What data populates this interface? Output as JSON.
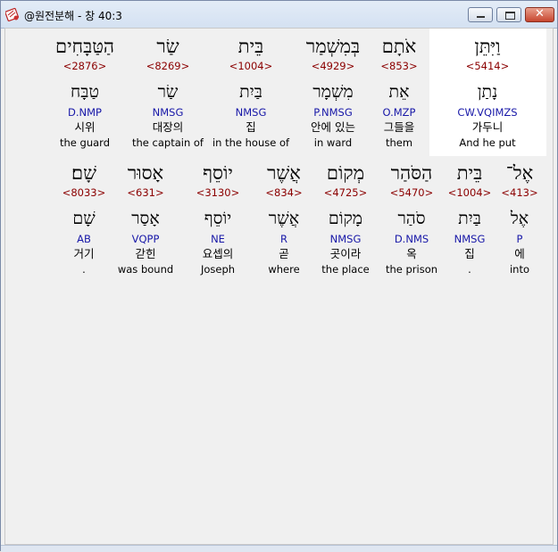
{
  "window": {
    "title": "@원전분해 - 창 40:3",
    "app_icon": "bible-tool-icon",
    "controls": [
      "minimize",
      "maximize",
      "close"
    ],
    "close_glyph": "✕"
  },
  "row1": [
    {
      "hebrew": "וַיִּתֵּן",
      "strong": "<5414>",
      "root": "נָתַן",
      "parse": "CW.VQIMZS",
      "korean": "가두니",
      "english": "And he put"
    },
    {
      "hebrew": "אֹתָם",
      "strong": "<853>",
      "root": "אֵת",
      "parse": "O.MZP",
      "korean": "그들을",
      "english": "them"
    },
    {
      "hebrew": "בְּמִשְׁמַר",
      "strong": "<4929>",
      "root": "מִשְׁמָר",
      "parse": "P.NMSG",
      "korean": "안에 있는",
      "english": "in ward"
    },
    {
      "hebrew": "בֵּית",
      "strong": "<1004>",
      "root": "בַּיִת",
      "parse": "NMSG",
      "korean": "집",
      "english": "in the house of"
    },
    {
      "hebrew": "שַׂר",
      "strong": "<8269>",
      "root": "שַׂר",
      "parse": "NMSG",
      "korean": "대장의",
      "english": "the captain of"
    },
    {
      "hebrew": "הַטַּבָּחִים",
      "strong": "<2876>",
      "root": "טַבָּח",
      "parse": "D.NMP",
      "korean": "시위",
      "english": "the guard"
    }
  ],
  "row2": [
    {
      "hebrew": "אֶל־",
      "strong": "<413>",
      "root": "אֶל",
      "parse": "P",
      "korean": "에",
      "english": "into"
    },
    {
      "hebrew": "בֵּית",
      "strong": "<1004>",
      "root": "בַּיִת",
      "parse": "NMSG",
      "korean": "집",
      "english": "."
    },
    {
      "hebrew": "הַסֹּהַר",
      "strong": "<5470>",
      "root": "סֹהַר",
      "parse": "D.NMS",
      "korean": "옥",
      "english": "the prison"
    },
    {
      "hebrew": "מְקוֹם",
      "strong": "<4725>",
      "root": "מָקוֹם",
      "parse": "NMSG",
      "korean": "곳이라",
      "english": "the place"
    },
    {
      "hebrew": "אֲשֶׁר",
      "strong": "<834>",
      "root": "אֲשֶׁר",
      "parse": "R",
      "korean": "곧",
      "english": "where"
    },
    {
      "hebrew": "יוֹסֵף",
      "strong": "<3130>",
      "root": "יוֹסֵף",
      "parse": "NE",
      "korean": "요셉의",
      "english": "Joseph"
    },
    {
      "hebrew": "אָסוּר",
      "strong": "<631>",
      "root": "אָסַר",
      "parse": "VQPP",
      "korean": "갇힌",
      "english": "was bound"
    },
    {
      "hebrew": "שָׁם׃",
      "strong": "<8033>",
      "root": "שָׁם",
      "parse": "AB",
      "korean": "거기",
      "english": "."
    }
  ]
}
